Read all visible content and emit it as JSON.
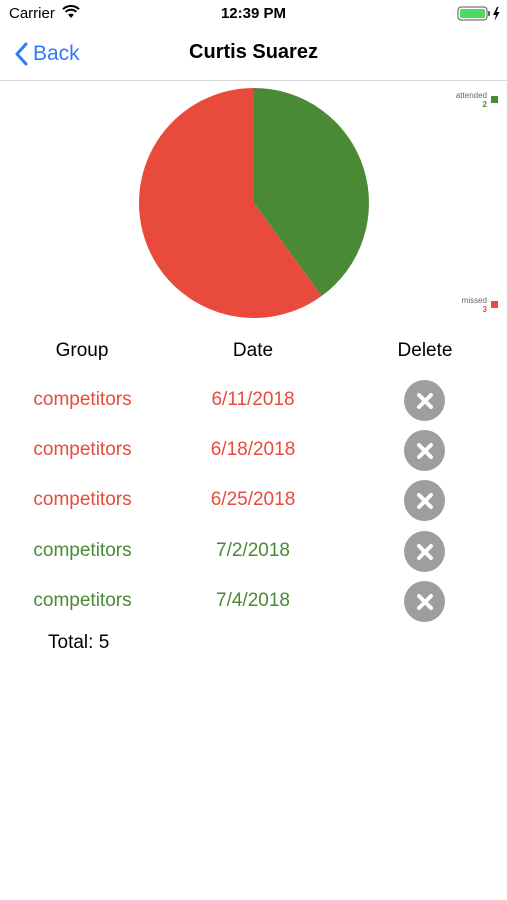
{
  "status_bar": {
    "carrier": "Carrier",
    "time": "12:39 PM",
    "icons": [
      "wifi-icon",
      "battery-icon",
      "charging-bolt-icon"
    ],
    "battery_color": "#4cd964"
  },
  "nav": {
    "back_label": "Back",
    "title": "Curtis Suarez",
    "accent_color": "#2f7cf6",
    "icons": [
      "chevron-left-icon"
    ]
  },
  "chart_data": {
    "type": "pie",
    "slices": [
      {
        "label": "attended",
        "value": 2,
        "color": "#4a8a35"
      },
      {
        "label": "missed",
        "value": 3,
        "color": "#e84b3c"
      }
    ],
    "legend": [
      {
        "label": "attended",
        "value": "2",
        "color": "#4a8a35"
      },
      {
        "label": "missed",
        "value": "3",
        "color": "#e84b3c"
      }
    ]
  },
  "table": {
    "headers": {
      "group": "Group",
      "date": "Date",
      "delete": "Delete"
    },
    "rows": [
      {
        "group": "competitors",
        "date": "6/11/2018",
        "status": "missed",
        "color": "#e84b3c"
      },
      {
        "group": "competitors",
        "date": "6/18/2018",
        "status": "missed",
        "color": "#e84b3c"
      },
      {
        "group": "competitors",
        "date": "6/25/2018",
        "status": "missed",
        "color": "#e84b3c"
      },
      {
        "group": "competitors",
        "date": "7/2/2018",
        "status": "attended",
        "color": "#4a8a35"
      },
      {
        "group": "competitors",
        "date": "7/4/2018",
        "status": "attended",
        "color": "#4a8a35"
      }
    ],
    "delete_icon": "close-icon"
  },
  "total_label": "Total: 5"
}
